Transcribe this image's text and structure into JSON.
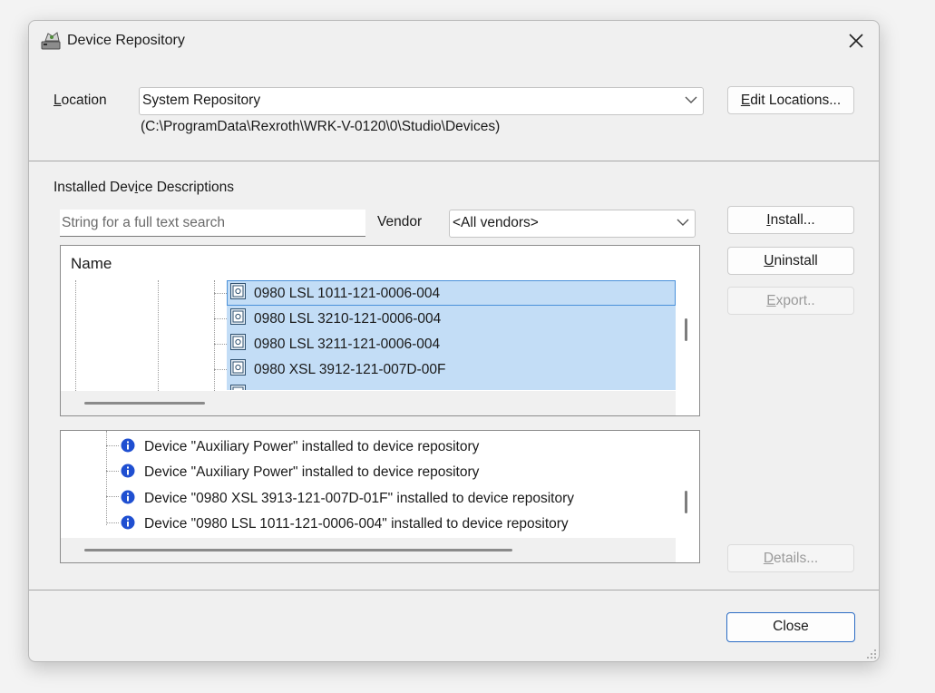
{
  "window": {
    "title": "Device Repository",
    "icon": "device-repository-icon",
    "close_icon": "close-icon"
  },
  "location": {
    "label_pre": "",
    "label_ul": "L",
    "label_post": "ocation",
    "value": "System Repository",
    "path": "(C:\\ProgramData\\Rexroth\\WRK-V-0120\\0\\Studio\\Devices)",
    "edit_pre": "",
    "edit_ul": "E",
    "edit_post": "dit Locations..."
  },
  "installed": {
    "heading_pre": "Installed Dev",
    "heading_ul": "i",
    "heading_post": "ce Descriptions",
    "search_placeholder": "String for a full text search",
    "vendor_label": "Vendor",
    "vendor_value": "<All vendors>",
    "tree_header": "Name",
    "rows": [
      {
        "label": "0980 LSL 1011-121-0006-004",
        "selected": true,
        "focused": true
      },
      {
        "label": "0980 LSL 3210-121-0006-004",
        "selected": true
      },
      {
        "label": "0980 LSL 3211-121-0006-004",
        "selected": true
      },
      {
        "label": "0980 XSL 3912-121-007D-00F",
        "selected": true
      }
    ]
  },
  "buttons": {
    "install_ul": "I",
    "install_post": "nstall...",
    "uninstall_ul": "U",
    "uninstall_post": "ninstall",
    "export_ul": "E",
    "export_post": "xport..",
    "details_ul": "D",
    "details_post": "etails...",
    "close": "Close",
    "install_enabled": true,
    "uninstall_enabled": true,
    "export_enabled": false,
    "details_enabled": false
  },
  "log": {
    "entries": [
      {
        "icon": "info-icon",
        "text": "Device \"Auxiliary Power\" installed to device repository"
      },
      {
        "icon": "info-icon",
        "text": "Device \"Auxiliary Power\" installed to device repository"
      },
      {
        "icon": "info-icon",
        "text": "Device \"0980 XSL 3913-121-007D-01F\" installed to device repository"
      },
      {
        "icon": "info-icon",
        "text": "Device \"0980 LSL 1011-121-0006-004\" installed to device repository"
      }
    ]
  },
  "colors": {
    "selection": "#c3ddf6",
    "accent": "#2b6cc4",
    "info_blue": "#1f4fd1"
  }
}
